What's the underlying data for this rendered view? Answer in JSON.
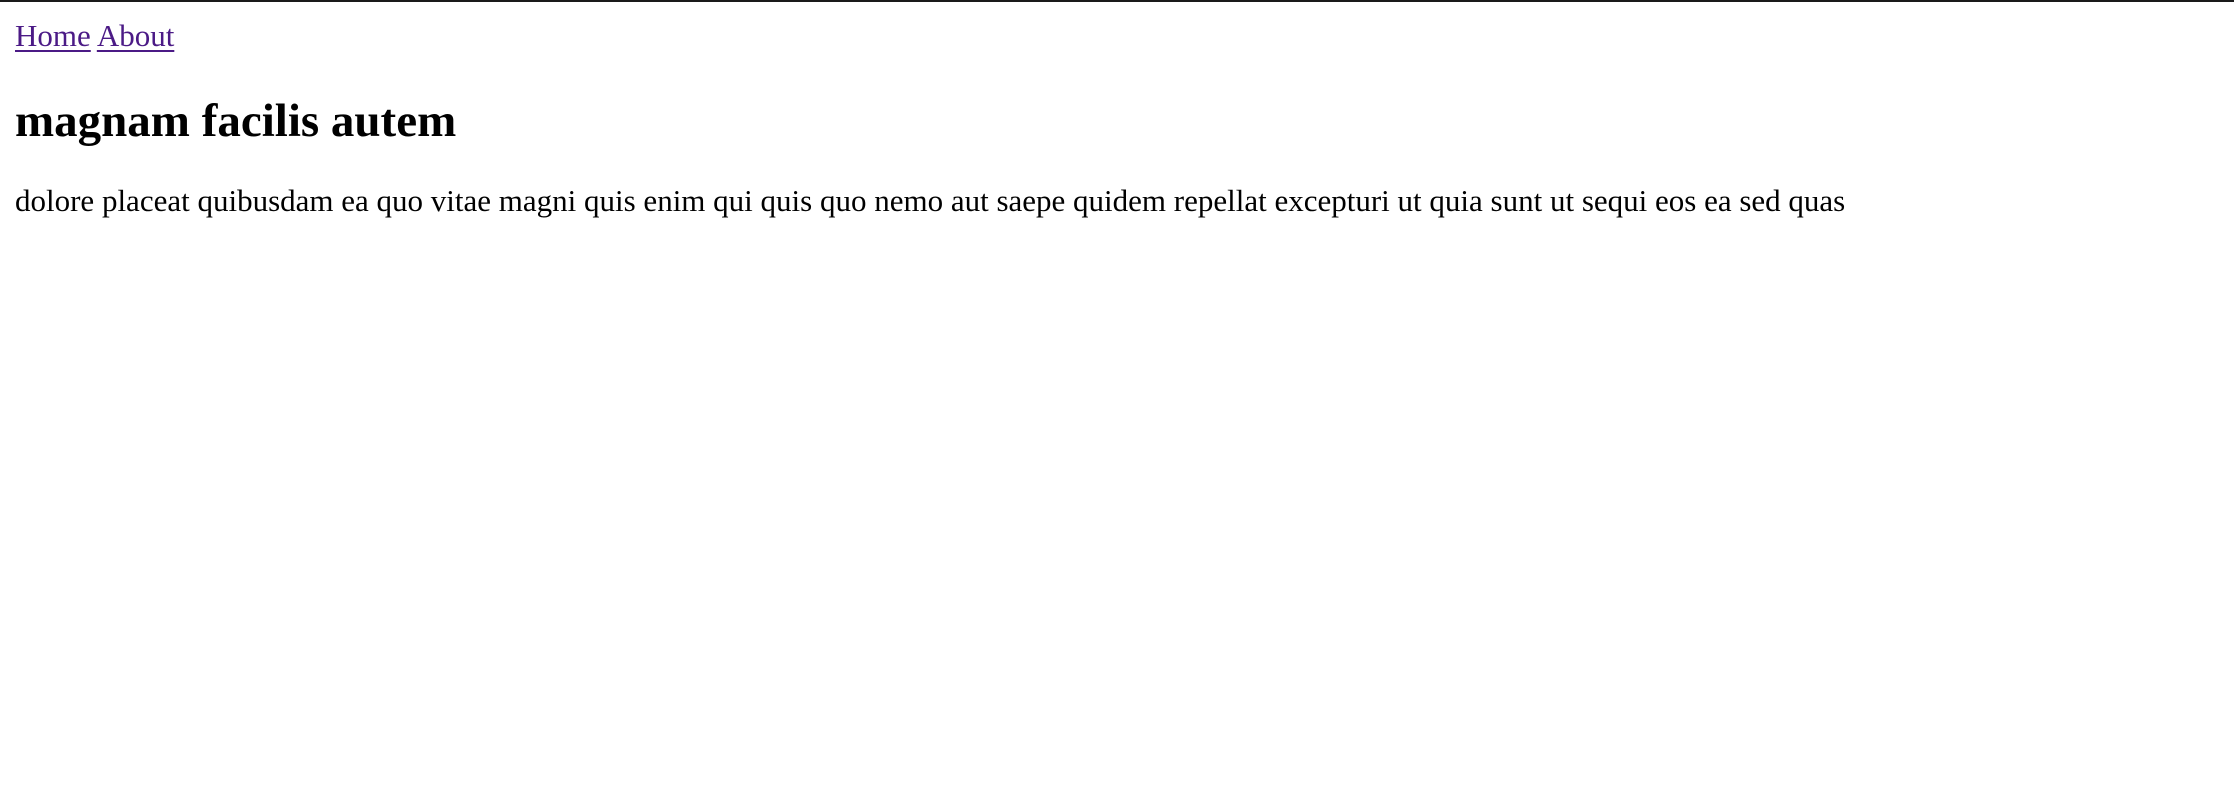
{
  "nav": {
    "home_label": "Home",
    "about_label": "About"
  },
  "main": {
    "title": "magnam facilis autem",
    "paragraph": "dolore placeat quibusdam ea quo vitae magni quis enim qui quis quo nemo aut saepe quidem repellat excepturi ut quia sunt ut sequi eos ea sed quas"
  },
  "colors": {
    "link": "#4b1a86",
    "text": "#000000",
    "background": "#ffffff",
    "top_rule": "#1a1a1a"
  }
}
